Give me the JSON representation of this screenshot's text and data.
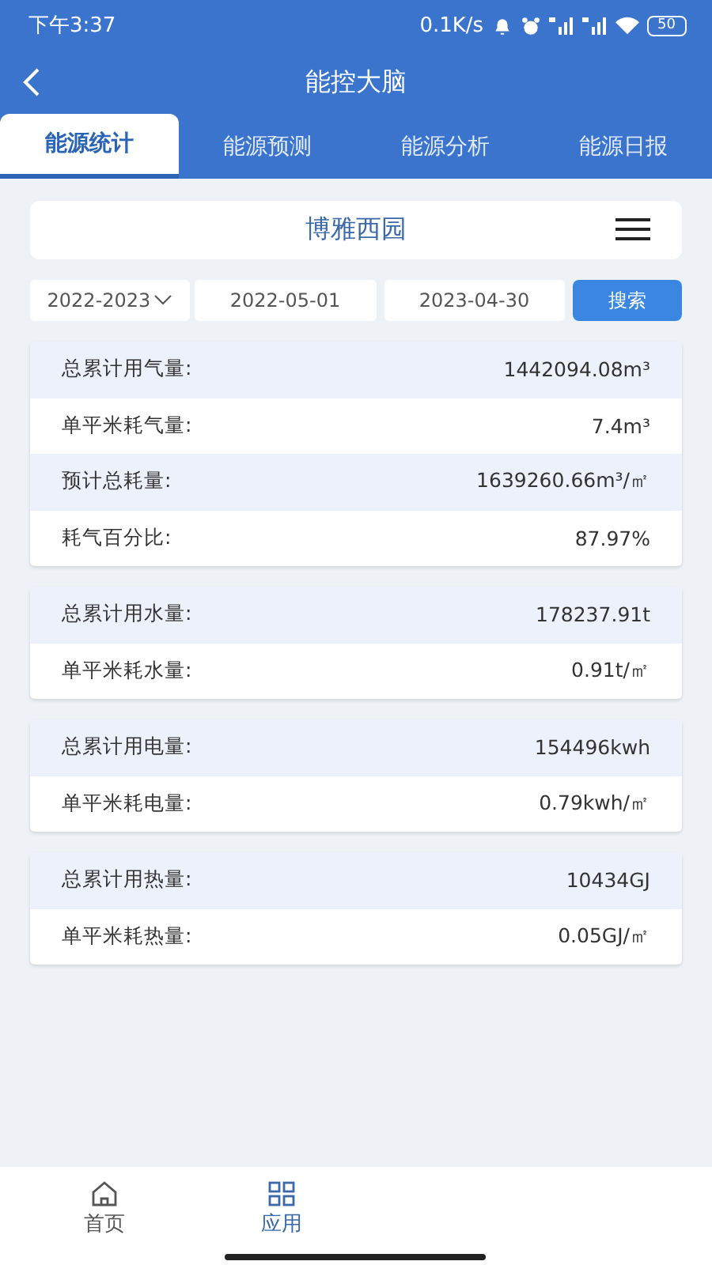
{
  "status_bar": {
    "time": "下午3:37",
    "speed": "0.1K/s",
    "battery": "50"
  },
  "header": {
    "title": "能控大脑"
  },
  "tabs": [
    {
      "label": "能源统计",
      "selected": true
    },
    {
      "label": "能源预测",
      "selected": false
    },
    {
      "label": "能源分析",
      "selected": false
    },
    {
      "label": "能源日报",
      "selected": false
    }
  ],
  "site": {
    "name": "博雅西园"
  },
  "filters": {
    "year": "2022-2023",
    "start_date": "2022-05-01",
    "end_date": "2023-04-30",
    "search_button": "搜索"
  },
  "groups": [
    {
      "rows": [
        {
          "label": "总累计用气量:",
          "value": "1442094.08m³"
        },
        {
          "label": "单平米耗气量:",
          "value": "7.4m³"
        },
        {
          "label": "预计总耗量:",
          "value": "1639260.66m³/㎡"
        },
        {
          "label": "耗气百分比:",
          "value": "87.97%"
        }
      ]
    },
    {
      "rows": [
        {
          "label": "总累计用水量:",
          "value": "178237.91t"
        },
        {
          "label": "单平米耗水量:",
          "value": "0.91t/㎡"
        }
      ]
    },
    {
      "rows": [
        {
          "label": "总累计用电量:",
          "value": "154496kwh"
        },
        {
          "label": "单平米耗电量:",
          "value": "0.79kwh/㎡"
        }
      ]
    },
    {
      "rows": [
        {
          "label": "总累计用热量:",
          "value": "10434GJ"
        },
        {
          "label": "单平米耗热量:",
          "value": "0.05GJ/㎡"
        }
      ]
    }
  ],
  "bottom_nav": [
    {
      "label": "首页",
      "kind": "home",
      "selected": false
    },
    {
      "label": "应用",
      "kind": "apps",
      "selected": true
    }
  ]
}
